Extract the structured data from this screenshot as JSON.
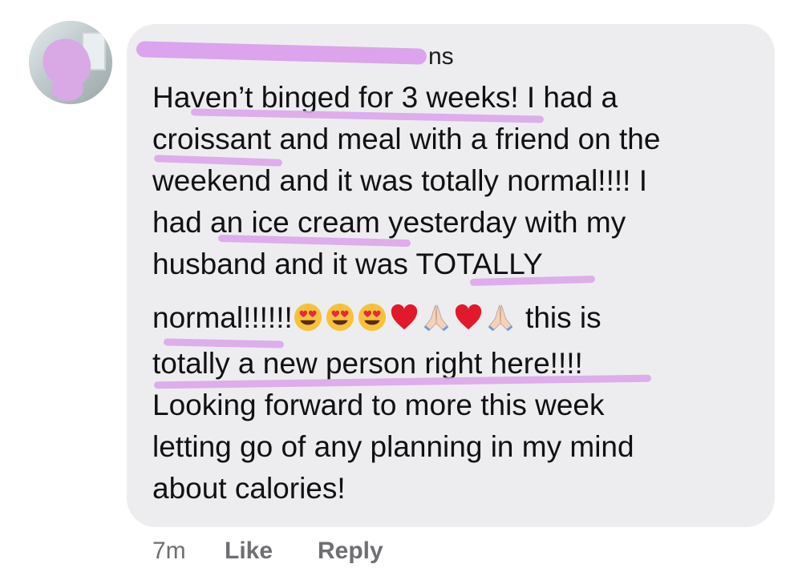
{
  "comment": {
    "author_visible_tail": "ns",
    "lines": [
      "Haven’t binged for 3 weeks! I had a",
      "croissant and meal with a friend on the",
      "weekend and it was totally normal!!!! I",
      "had an ice cream yesterday with my",
      "husband and it was TOTALLY"
    ],
    "line6_start": "normal!!!!!!",
    "line6_end": " this is",
    "lines_after": [
      "totally a new person right here!!!!",
      "Looking forward to more this week",
      "letting go of any planning in my mind",
      "about calories!"
    ],
    "emojis": [
      "heart-eyes-emoji",
      "heart-eyes-emoji",
      "heart-eyes-emoji",
      "red-heart-emoji",
      "praying-hands-emoji",
      "red-heart-emoji",
      "praying-hands-emoji"
    ]
  },
  "footer": {
    "time": "7m",
    "like_label": "Like",
    "reply_label": "Reply"
  },
  "colors": {
    "bubble": "#ededf0",
    "highlight": "#dca7ea",
    "text": "#111111",
    "meta": "#6e6e73"
  }
}
